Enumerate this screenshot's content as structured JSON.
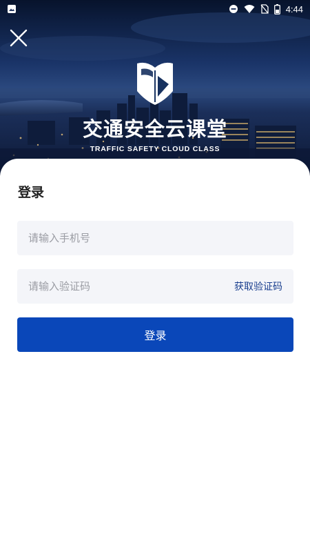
{
  "status_bar": {
    "time": "4:44",
    "icons": [
      "gallery-icon",
      "dnd-icon",
      "wifi-icon",
      "no-sim-icon",
      "battery-icon"
    ]
  },
  "header": {
    "close_icon": "close-icon",
    "logo_icon": "book-shield-icon",
    "app_title": "交通安全云课堂",
    "app_subtitle": "TRAFFIC SAFETY CLOUD CLASS"
  },
  "login": {
    "title": "登录",
    "phone_placeholder": "请输入手机号",
    "phone_value": "",
    "code_placeholder": "请输入验证码",
    "code_value": "",
    "get_code_label": "获取验证码",
    "submit_label": "登录"
  },
  "colors": {
    "primary": "#0a47b9",
    "link": "#1a3f8f",
    "field_bg": "#f4f5f9",
    "placeholder": "#9a9ca3"
  }
}
